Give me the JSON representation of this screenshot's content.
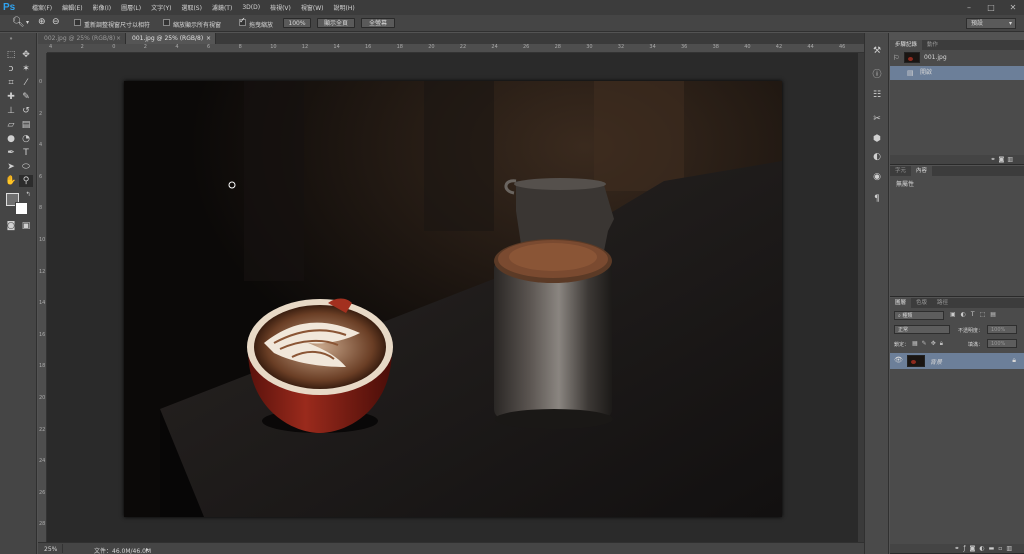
{
  "app": {
    "logo": "Ps"
  },
  "menu": [
    "檔案(F)",
    "編輯(E)",
    "影像(I)",
    "圖層(L)",
    "文字(Y)",
    "選取(S)",
    "濾鏡(T)",
    "3D(D)",
    "檢視(V)",
    "視窗(W)",
    "說明(H)"
  ],
  "window_controls": {
    "minimize": "–",
    "maximize": "□",
    "close": "✕"
  },
  "options": {
    "tool_icon": "zoom-icon",
    "zoom_in": "⊕",
    "zoom_out": "⊖",
    "resize_windows_label": "重新調整視窗尺寸以相符",
    "resize_windows_checked": false,
    "zoom_all_label": "縮放顯示所有視窗",
    "zoom_all_checked": false,
    "scrubby_label": "拖曳縮放",
    "scrubby_checked": true,
    "btn_100": "100%",
    "btn_fit": "顯示全頁",
    "btn_fill": "全螢幕",
    "workspace": "預設"
  },
  "tabs": [
    {
      "label": "002.jpg @ 25% (RGB/8)",
      "close": "×",
      "active": false
    },
    {
      "label": "001.jpg @ 25% (RGB/8)",
      "close": "×",
      "active": true
    }
  ],
  "ruler": {
    "h_ticks": [
      "4",
      "2",
      "0",
      "2",
      "4",
      "6",
      "8",
      "10",
      "12",
      "14",
      "16",
      "18",
      "20",
      "22",
      "24",
      "26",
      "28",
      "30",
      "32",
      "34",
      "36",
      "38",
      "40",
      "42",
      "44",
      "46"
    ],
    "v_ticks": [
      "0",
      "2",
      "4",
      "6",
      "8",
      "10",
      "12",
      "14",
      "16",
      "18",
      "20",
      "22",
      "24",
      "26",
      "28"
    ]
  },
  "status": {
    "zoom": "25%",
    "doc_info": "文件：46.0M/46.0M"
  },
  "history_panel": {
    "tabs": [
      "步驟記錄",
      "動作"
    ],
    "snapshot": "001.jpg",
    "step": "開啟"
  },
  "properties_panel": {
    "tabs": [
      "字元",
      "內容"
    ],
    "text": "無屬性"
  },
  "layers_panel": {
    "tabs": [
      "圖層",
      "色版",
      "路徑"
    ],
    "filter_kind": "種類",
    "blend_mode": "正常",
    "opacity_label": "不透明度：",
    "opacity_value": "100%",
    "lock_label": "鎖定：",
    "fill_label": "填滿：",
    "fill_value": "100%",
    "layer_name": "背景"
  },
  "colors": {
    "accent": "#2fa3f0",
    "selection": "#6c7f99",
    "cup_red": "#8e2a1e"
  }
}
